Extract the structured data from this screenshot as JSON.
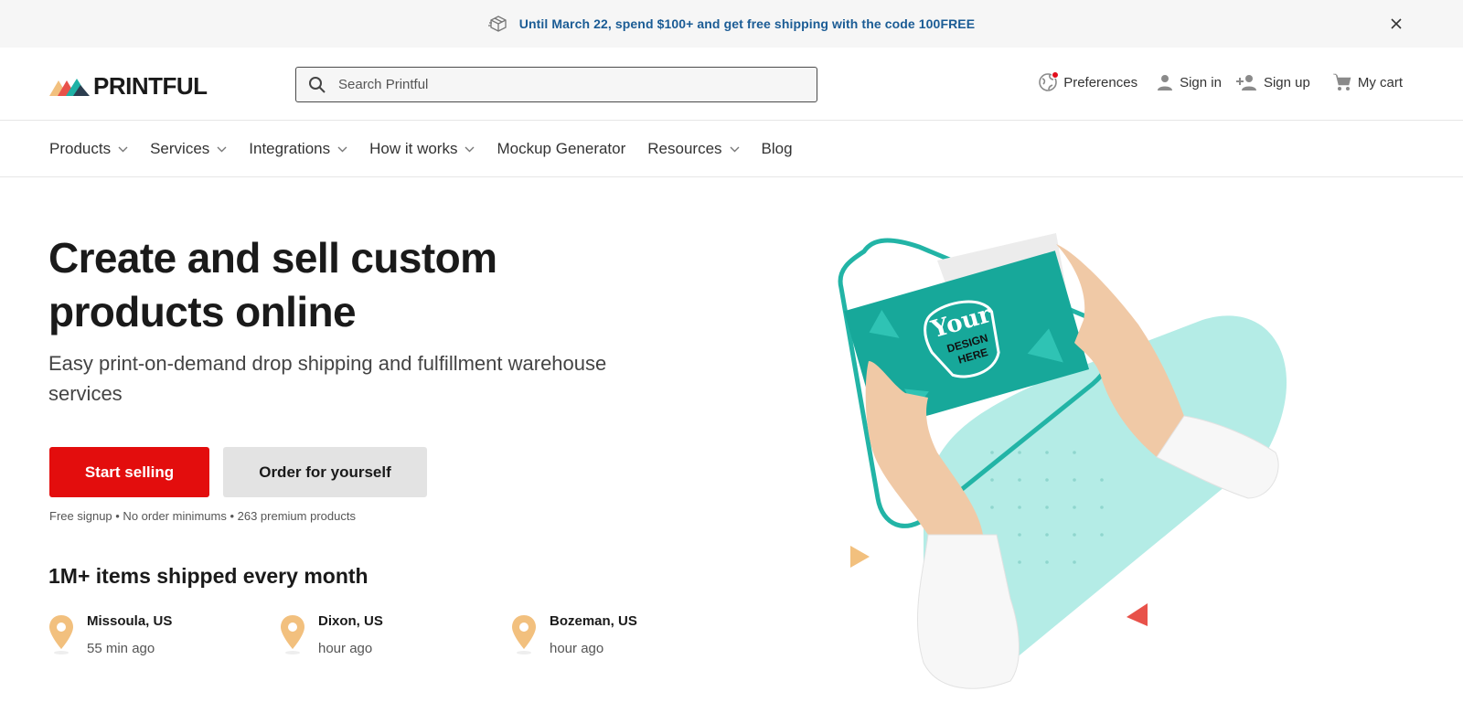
{
  "promo": {
    "text": "Until March 22, spend $100+ and get free shipping with the code 100FREE",
    "icon": "package-icon",
    "close_icon": "close-icon",
    "color": "#1b5c95"
  },
  "header": {
    "logo_text": "PRINTFUL",
    "search_placeholder": "Search Printful",
    "actions": {
      "preferences": "Preferences",
      "sign_in": "Sign in",
      "sign_up": "Sign up",
      "cart": "My cart"
    }
  },
  "nav": {
    "items": [
      {
        "label": "Products",
        "has_dropdown": true
      },
      {
        "label": "Services",
        "has_dropdown": true
      },
      {
        "label": "Integrations",
        "has_dropdown": true
      },
      {
        "label": "How it works",
        "has_dropdown": true
      },
      {
        "label": "Mockup Generator",
        "has_dropdown": false
      },
      {
        "label": "Resources",
        "has_dropdown": true
      },
      {
        "label": "Blog",
        "has_dropdown": false
      }
    ]
  },
  "hero": {
    "title": "Create and sell custom products online",
    "subtitle": "Easy print-on-demand drop shipping and fulfillment warehouse services",
    "primary_cta": "Start selling",
    "secondary_cta": "Order for yourself",
    "fine_print": "Free signup • No order minimums • 263 premium products",
    "card_text": {
      "line1": "Your",
      "line2": "DESIGN",
      "line3": "HERE"
    }
  },
  "shipped": {
    "title": "1M+ items shipped every month",
    "locations": [
      {
        "city": "Missoula, US",
        "time": "55 min ago"
      },
      {
        "city": "Dixon, US",
        "time": "hour ago"
      },
      {
        "city": "Bozeman, US",
        "time": "hour ago"
      }
    ]
  },
  "colors": {
    "accent_red": "#e30d0d",
    "teal": "#1fb2a6",
    "pin": "#f2c07e"
  }
}
